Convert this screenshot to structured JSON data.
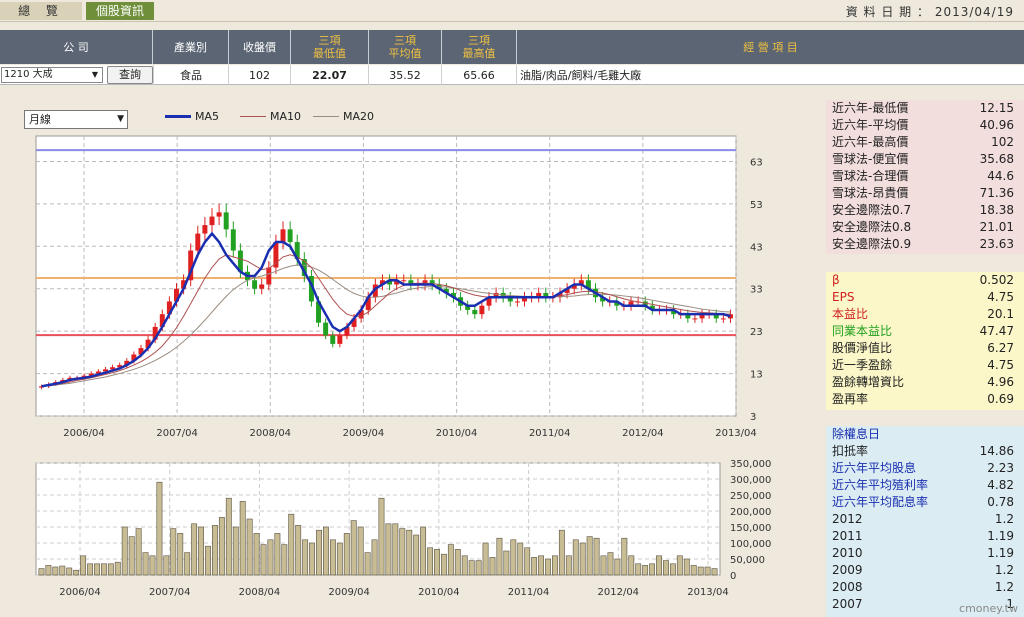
{
  "tabs": [
    {
      "label": "總 覽"
    },
    {
      "label": "個股資訊"
    }
  ],
  "date_label": "資 料 日 期 ：",
  "date_value": "2013/04/19",
  "header": {
    "company": "公 司",
    "industry": "產業別",
    "close": "收盤價",
    "min_l1": "三項",
    "min_l2": "最低值",
    "avg_l1": "三項",
    "avg_l2": "平均值",
    "max_l1": "三項",
    "max_l2": "最高值",
    "business": "經 營 項 目"
  },
  "row": {
    "stock": "1210 大成",
    "query": "查詢",
    "industry": "食品",
    "close": "102",
    "min": "22.07",
    "avg": "35.52",
    "max": "65.66",
    "business": "油脂/肉品/飼料/毛雞大廠"
  },
  "period_select": "月線",
  "legend": [
    {
      "name": "MA5",
      "color": "#1a2fb0"
    },
    {
      "name": "MA10",
      "color": "#b05050"
    },
    {
      "name": "MA20",
      "color": "#9a8c80"
    }
  ],
  "colors": {
    "up": "#e02020",
    "down": "#22a022",
    "volume": "#c8bc94",
    "ma5": "#1a2fb0",
    "ma10": "#b05050",
    "ma20": "#9a8c80",
    "ref_low": "#e8505a",
    "ref_mid": "#f0b070",
    "ref_high": "#8a8ae8"
  },
  "chart_data": [
    {
      "type": "candlestick",
      "x_labels": [
        "2006/04",
        "2007/04",
        "2008/04",
        "2009/04",
        "2010/04",
        "2011/04",
        "2012/04",
        "2013/04"
      ],
      "y_ticks": [
        "63",
        "53",
        "43",
        "33",
        "23",
        "13",
        "3"
      ],
      "ylim": [
        3,
        69
      ],
      "ref_lines": [
        65.66,
        35.52,
        22.07
      ],
      "grid": true,
      "close": [
        10,
        10.5,
        11,
        11.5,
        12,
        12,
        12.5,
        13,
        13.5,
        14,
        14.5,
        15,
        16,
        17.5,
        19,
        21,
        24,
        27,
        30,
        33,
        35,
        42,
        46,
        48,
        50,
        51,
        47,
        42,
        37,
        35,
        33,
        34,
        38,
        44,
        47,
        44,
        40,
        36,
        30,
        25,
        22,
        20,
        22,
        24,
        26,
        28,
        31,
        34,
        35,
        34,
        35,
        35,
        34,
        34,
        35,
        34,
        33,
        32,
        31,
        29,
        28,
        27,
        29,
        31,
        32,
        31,
        30,
        30,
        31,
        31,
        32,
        31,
        31,
        32,
        33,
        34,
        35,
        33,
        31,
        30,
        30,
        29,
        29,
        30,
        30,
        29,
        28,
        28,
        28,
        27,
        27,
        26,
        26,
        27,
        27,
        26,
        26,
        27
      ],
      "ma5": [
        10,
        10.3,
        10.6,
        11,
        11.5,
        11.8,
        12,
        12.3,
        12.8,
        13.2,
        13.7,
        14.2,
        15,
        16,
        17.3,
        19,
        21.3,
        24,
        27,
        30,
        33,
        37,
        41,
        44,
        46,
        44,
        41,
        39,
        37,
        36,
        36,
        38,
        42,
        44,
        44,
        43,
        40,
        37,
        34,
        30,
        27,
        24,
        23,
        24,
        26,
        28,
        31,
        33,
        34,
        35,
        35,
        34,
        34,
        34,
        34,
        34,
        33,
        32,
        31,
        30,
        29,
        29,
        30,
        31,
        31,
        31,
        31,
        31,
        31,
        31,
        31,
        31,
        31,
        32,
        33,
        34,
        34,
        33,
        32,
        31,
        30,
        30,
        29,
        29,
        29,
        29,
        28,
        28,
        28,
        28,
        27,
        27,
        27,
        27,
        27,
        27,
        27,
        26.5
      ],
      "ma10": [
        10,
        10.2,
        10.4,
        10.7,
        11,
        11.4,
        11.7,
        12,
        12.4,
        12.8,
        13.2,
        13.7,
        14.3,
        15,
        15.8,
        16.8,
        18,
        19.5,
        21.5,
        23.8,
        26.5,
        29.5,
        32.5,
        35.5,
        38,
        40,
        41,
        40.5,
        40,
        39.5,
        38.5,
        37.5,
        37.8,
        39,
        40.5,
        41,
        40.5,
        39.5,
        38,
        35.5,
        33,
        30.5,
        28.5,
        27,
        26.5,
        26.5,
        27.5,
        29,
        30.5,
        32,
        33,
        33.8,
        34.2,
        34.3,
        34.3,
        34.2,
        34,
        33.7,
        33.2,
        32.6,
        32,
        31.5,
        31.2,
        31,
        31,
        31,
        31,
        31,
        31,
        31,
        31,
        31,
        31.1,
        31.3,
        31.6,
        32,
        32.3,
        32.4,
        32.3,
        32,
        31.6,
        31.1,
        30.6,
        30.2,
        29.9,
        29.6,
        29.3,
        29,
        28.7,
        28.4,
        28.1,
        27.8,
        27.6,
        27.4,
        27.3,
        27.2,
        27,
        27
      ],
      "ma20": [
        10,
        10.1,
        10.3,
        10.5,
        10.7,
        11,
        11.3,
        11.6,
        11.9,
        12.2,
        12.6,
        13,
        13.5,
        14,
        14.6,
        15.3,
        16.1,
        17,
        18,
        19.2,
        20.6,
        22.1,
        23.8,
        25.6,
        27.5,
        29.4,
        31.2,
        32.8,
        34,
        35,
        35.6,
        36,
        36.5,
        37.1,
        37.8,
        38.3,
        38.6,
        38.5,
        38.1,
        37.4,
        36.4,
        35.2,
        34,
        32.8,
        31.9,
        31.3,
        31,
        31,
        31.2,
        31.6,
        32,
        32.5,
        32.9,
        33.2,
        33.4,
        33.5,
        33.5,
        33.4,
        33.2,
        33,
        32.7,
        32.4,
        32.1,
        31.9,
        31.7,
        31.5,
        31.4,
        31.3,
        31.2,
        31.2,
        31.1,
        31.1,
        31.1,
        31.1,
        31.2,
        31.3,
        31.5,
        31.6,
        31.7,
        31.7,
        31.6,
        31.5,
        31.3,
        31.1,
        30.9,
        30.6,
        30.3,
        30,
        29.7,
        29.4,
        29.1,
        28.8,
        28.5,
        28.2,
        28,
        27.8,
        27.6,
        27.5
      ]
    },
    {
      "type": "bar",
      "x_labels": [
        "2006/04",
        "2007/04",
        "2008/04",
        "2009/04",
        "2010/04",
        "2011/04",
        "2012/04",
        "2013/04"
      ],
      "y_ticks": [
        "350,000",
        "300,000",
        "250,000",
        "200,000",
        "150,000",
        "100,000",
        "50,000",
        "0"
      ],
      "ylim": [
        0,
        350000
      ],
      "values": [
        20000,
        30000,
        25000,
        28000,
        22000,
        15000,
        60000,
        35000,
        35000,
        35000,
        35000,
        40000,
        150000,
        120000,
        145000,
        70000,
        60000,
        290000,
        60000,
        145000,
        130000,
        70000,
        160000,
        150000,
        90000,
        155000,
        180000,
        240000,
        150000,
        230000,
        175000,
        130000,
        95000,
        110000,
        130000,
        95000,
        190000,
        155000,
        110000,
        100000,
        140000,
        150000,
        110000,
        100000,
        130000,
        170000,
        150000,
        70000,
        110000,
        240000,
        160000,
        160000,
        145000,
        140000,
        125000,
        150000,
        85000,
        80000,
        65000,
        95000,
        80000,
        60000,
        45000,
        45000,
        100000,
        55000,
        115000,
        75000,
        110000,
        100000,
        85000,
        55000,
        60000,
        50000,
        60000,
        140000,
        60000,
        110000,
        100000,
        120000,
        115000,
        60000,
        70000,
        50000,
        115000,
        60000,
        35000,
        30000,
        35000,
        60000,
        45000,
        35000,
        60000,
        50000,
        30000,
        25000,
        25000,
        20000
      ]
    }
  ],
  "side_top": [
    {
      "label": "近六年-最低價",
      "value": "12.15"
    },
    {
      "label": "近六年-平均價",
      "value": "40.96"
    },
    {
      "label": "近六年-最高價",
      "value": "102"
    },
    {
      "label": "雪球法-便宜價",
      "value": "35.68"
    },
    {
      "label": "雪球法-合理價",
      "value": "44.6"
    },
    {
      "label": "雪球法-昂貴價",
      "value": "71.36"
    },
    {
      "label": "安全邊際法0.7",
      "value": "18.38"
    },
    {
      "label": "安全邊際法0.8",
      "value": "21.01"
    },
    {
      "label": "安全邊際法0.9",
      "value": "23.63"
    }
  ],
  "side_mid": [
    {
      "label": "β",
      "value": "0.502",
      "color": "#d02020"
    },
    {
      "label": "EPS",
      "value": "4.75",
      "color": "#d02020"
    },
    {
      "label": "本益比",
      "value": "20.1",
      "color": "#d02020"
    },
    {
      "label": "同業本益比",
      "value": "47.47",
      "color": "#20a020"
    },
    {
      "label": "股價淨值比",
      "value": "6.27",
      "color": "#222222"
    },
    {
      "label": "近一季盈餘",
      "value": "4.75",
      "color": "#222222"
    },
    {
      "label": "盈餘轉增資比",
      "value": "4.96",
      "color": "#222222"
    },
    {
      "label": "盈再率",
      "value": "0.69",
      "color": "#222222"
    }
  ],
  "side_bottom_title": "除權息日",
  "side_bottom": [
    {
      "label": "扣抵率",
      "value": "14.86",
      "color": "#222222"
    },
    {
      "label": "近六年平均股息",
      "value": "2.23",
      "color": "#1a2fb0"
    },
    {
      "label": "近六年平均殖利率",
      "value": "4.82",
      "color": "#1a2fb0"
    },
    {
      "label": "近六年平均配息率",
      "value": "0.78",
      "color": "#1a2fb0"
    },
    {
      "label": "2012",
      "value": "1.2",
      "color": "#222222"
    },
    {
      "label": "2011",
      "value": "1.19",
      "color": "#222222"
    },
    {
      "label": "2010",
      "value": "1.19",
      "color": "#222222"
    },
    {
      "label": "2009",
      "value": "1.2",
      "color": "#222222"
    },
    {
      "label": "2008",
      "value": "1.2",
      "color": "#222222"
    },
    {
      "label": "2007",
      "value": "1",
      "color": "#222222"
    }
  ],
  "watermark": "cmoney.tw"
}
